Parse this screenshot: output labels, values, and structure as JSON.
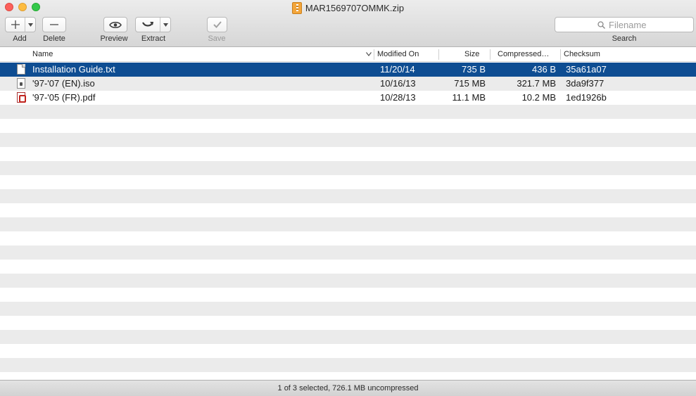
{
  "window": {
    "title": "MAR1569707OMMK.zip"
  },
  "toolbar": {
    "add_label": "Add",
    "delete_label": "Delete",
    "preview_label": "Preview",
    "extract_label": "Extract",
    "save_label": "Save",
    "search_label": "Search",
    "search_placeholder": "Filename"
  },
  "table": {
    "columns": [
      "Name",
      "Modified On",
      "Size",
      "Compressed…",
      "Checksum"
    ],
    "rows": [
      {
        "icon": "text-file-icon",
        "name": "Installation Guide.txt",
        "modified": "11/20/14",
        "size": "735 B",
        "compressed": "436 B",
        "checksum": "35a61a07",
        "selected": true
      },
      {
        "icon": "disk-image-icon",
        "name": "'97-'07 (EN).iso",
        "modified": "10/16/13",
        "size": "715 MB",
        "compressed": "321.7 MB",
        "checksum": "3da9f377",
        "selected": false
      },
      {
        "icon": "pdf-file-icon",
        "name": "'97-'05 (FR).pdf",
        "modified": "10/28/13",
        "size": "11.1 MB",
        "compressed": "10.2 MB",
        "checksum": "1ed1926b",
        "selected": false
      }
    ]
  },
  "status": {
    "text": "1 of 3 selected, 726.1 MB uncompressed"
  },
  "colors": {
    "selection": "#0e4d92",
    "stripe": "#ebebeb"
  }
}
